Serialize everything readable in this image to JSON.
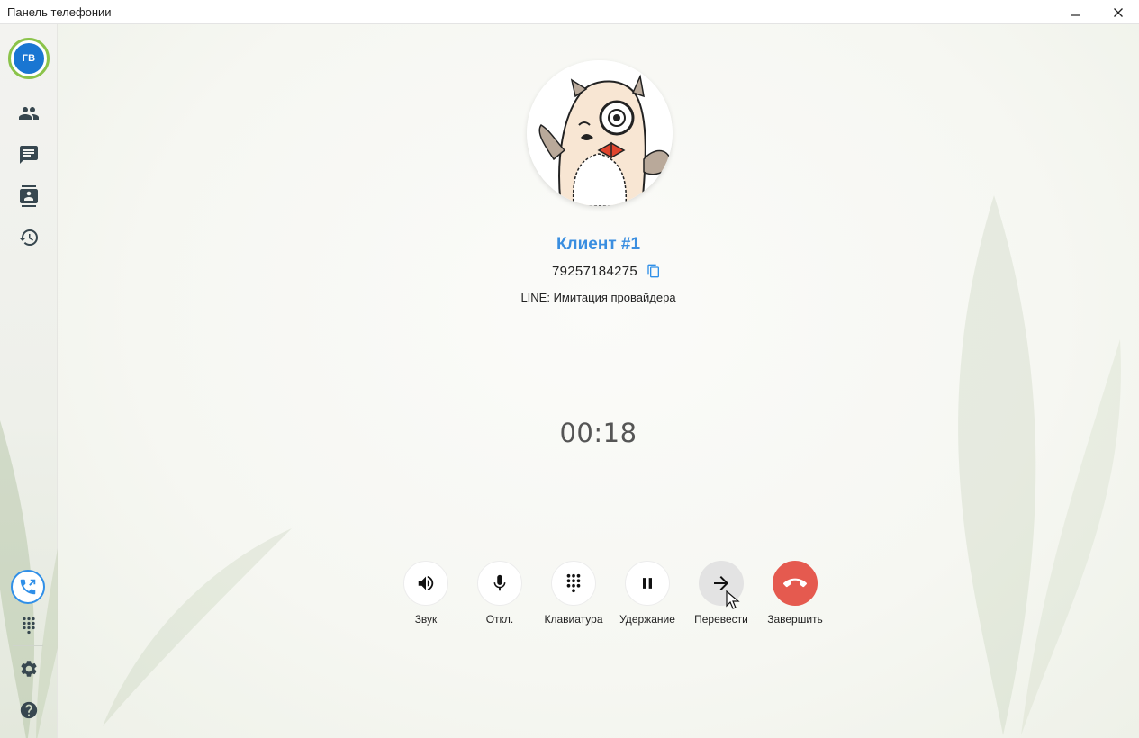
{
  "window": {
    "title": "Панель телефонии"
  },
  "sidebar": {
    "avatar_initials": "ГВ",
    "items": [
      {
        "icon": "people-icon"
      },
      {
        "icon": "chat-icon"
      },
      {
        "icon": "contacts-icon"
      },
      {
        "icon": "history-icon"
      }
    ],
    "bottom": [
      {
        "icon": "phone-call-icon",
        "active": true
      },
      {
        "icon": "dialpad-icon"
      },
      {
        "icon": "settings-icon"
      },
      {
        "icon": "help-icon"
      }
    ]
  },
  "call": {
    "name": "Клиент #1",
    "number": "79257184275",
    "line_label": "LINE:",
    "line_value": "Имитация провайдера",
    "timer": "00:18"
  },
  "controls": [
    {
      "id": "sound",
      "label": "Звук",
      "icon": "volume-icon"
    },
    {
      "id": "mute",
      "label": "Откл.",
      "icon": "microphone-icon"
    },
    {
      "id": "keypad",
      "label": "Клавиатура",
      "icon": "dialpad-icon"
    },
    {
      "id": "hold",
      "label": "Удержание",
      "icon": "pause-icon"
    },
    {
      "id": "transfer",
      "label": "Перевести",
      "icon": "arrow-right-icon"
    },
    {
      "id": "hangup",
      "label": "Завершить",
      "icon": "hangup-icon"
    }
  ],
  "colors": {
    "accent": "#3a8ee0",
    "avatar": "#1976d2",
    "avatar_ring": "#8bc34a",
    "hangup": "#e55a4f",
    "active_phone": "#2f8fe8"
  }
}
